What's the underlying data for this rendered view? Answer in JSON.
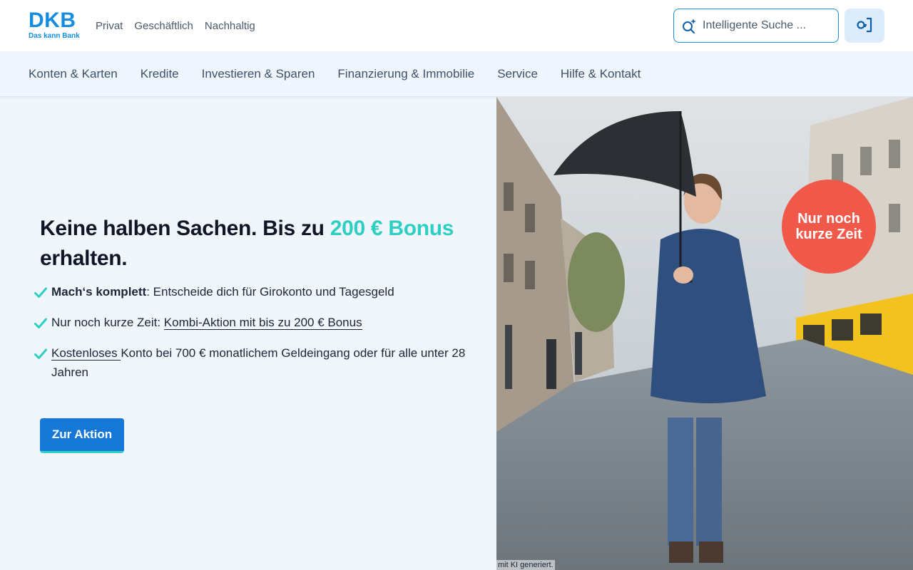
{
  "brand": {
    "name": "DKB",
    "tagline": "Das kann Bank",
    "color": "#148ddf"
  },
  "segments": [
    "Privat",
    "Geschäftlich",
    "Nachhaltig"
  ],
  "search": {
    "placeholder": "Intelligente Suche ...",
    "icon": "sparkle-search-icon"
  },
  "login": {
    "icon": "login-key-icon"
  },
  "main_nav": [
    "Konten & Karten",
    "Kredite",
    "Investieren & Sparen",
    "Finanzierung & Immobilie",
    "Service",
    "Hilfe & Kontakt"
  ],
  "hero": {
    "headline_part1": "Keine halben Sachen. Bis zu ",
    "headline_accent": "200 € Bonus",
    "headline_part2": " erhalten.",
    "bullets": [
      {
        "bold": "Mach‘s komplett",
        "text": ": Entscheide dich für Girokonto und Tagesgeld"
      },
      {
        "prefix": "Nur noch kurze Zeit: ",
        "link": "Kombi-Aktion mit bis zu 200 € Bonus"
      },
      {
        "link": "Kostenloses ",
        "text": "Konto bei 700 € monatlichem Geldeingang oder für alle unter 28 Jahren"
      }
    ],
    "cta_label": "Zur Aktion",
    "badge_line1": "Nur noch",
    "badge_line2": "kurze Zeit",
    "image_caption": "mit KI generiert."
  },
  "colors": {
    "accent": "#2ecfc3",
    "primary_button": "#1577d6",
    "badge": "#f0594a"
  }
}
